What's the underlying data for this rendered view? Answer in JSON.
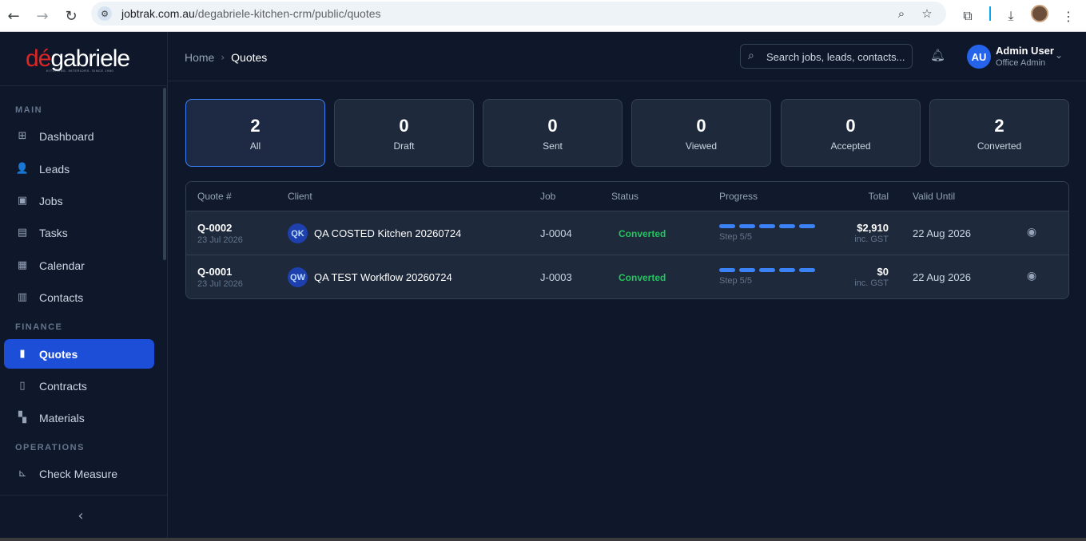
{
  "browser": {
    "url_host": "jobtrak.com.au",
    "url_path": "/degabriele-kitchen-crm/public/quotes",
    "nav_icons": [
      "back-arrow-icon",
      "forward-arrow-icon",
      "reload-icon"
    ],
    "toolbar_icons": [
      "zoom-icon",
      "bookmark-star-icon",
      "extensions-icon",
      "download-icon",
      "menu-icon"
    ]
  },
  "brand": {
    "logo_text_red": "dé",
    "logo_text_white": "gabriele",
    "logo_tagline": "KITCHENS. INTERIORS. SINCE 1980"
  },
  "sidebar": {
    "sections": [
      {
        "title": "MAIN",
        "items": [
          {
            "label": "Dashboard",
            "icon": "grid-icon"
          },
          {
            "label": "Leads",
            "icon": "user-plus-icon"
          },
          {
            "label": "Jobs",
            "icon": "briefcase-icon"
          },
          {
            "label": "Tasks",
            "icon": "toolbox-icon"
          },
          {
            "label": "Calendar",
            "icon": "calendar-icon"
          },
          {
            "label": "Contacts",
            "icon": "address-book-icon"
          }
        ]
      },
      {
        "title": "FINANCE",
        "items": [
          {
            "label": "Quotes",
            "icon": "invoice-icon",
            "active": true
          },
          {
            "label": "Contracts",
            "icon": "document-icon"
          },
          {
            "label": "Materials",
            "icon": "boxes-icon"
          }
        ]
      },
      {
        "title": "OPERATIONS",
        "items": [
          {
            "label": "Check Measure",
            "icon": "ruler-icon"
          }
        ]
      }
    ]
  },
  "header": {
    "breadcrumb_home": "Home",
    "breadcrumb_current": "Quotes",
    "search_placeholder": "Search jobs, leads, contacts...",
    "user_initials": "AU",
    "user_name": "Admin User",
    "user_role": "Office Admin"
  },
  "stats": [
    {
      "count": "2",
      "label": "All",
      "active": true
    },
    {
      "count": "0",
      "label": "Draft"
    },
    {
      "count": "0",
      "label": "Sent"
    },
    {
      "count": "0",
      "label": "Viewed"
    },
    {
      "count": "0",
      "label": "Accepted"
    },
    {
      "count": "2",
      "label": "Converted"
    }
  ],
  "table": {
    "columns": [
      "Quote #",
      "Client",
      "Job",
      "Status",
      "Progress",
      "Total",
      "Valid Until"
    ],
    "rows": [
      {
        "quote": "Q-0002",
        "date": "23 Jul 2026",
        "client_initials": "QK",
        "client": "QA COSTED Kitchen 20260724",
        "job": "J-0004",
        "status": "Converted",
        "progress_steps_done": 5,
        "progress_steps_total": 5,
        "step_text": "Step 5/5",
        "total": "$2,910",
        "tax_note": "inc. GST",
        "valid_until": "22 Aug 2026"
      },
      {
        "quote": "Q-0001",
        "date": "23 Jul 2026",
        "client_initials": "QW",
        "client": "QA TEST Workflow 20260724",
        "job": "J-0003",
        "status": "Converted",
        "progress_steps_done": 5,
        "progress_steps_total": 5,
        "step_text": "Step 5/5",
        "total": "$0",
        "tax_note": "inc. GST",
        "valid_until": "22 Aug 2026"
      }
    ]
  },
  "colors": {
    "background": "#0f172a",
    "accent": "#1d4ed8",
    "status_converted": "#22c55e",
    "brand_red": "#dc2626"
  }
}
